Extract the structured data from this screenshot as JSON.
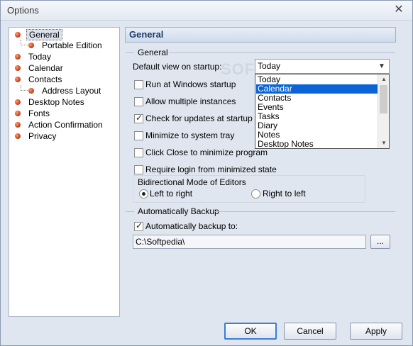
{
  "window": {
    "title": "Options"
  },
  "tree": {
    "items": [
      {
        "label": "General"
      },
      {
        "label": "Portable Edition"
      },
      {
        "label": "Today"
      },
      {
        "label": "Calendar"
      },
      {
        "label": "Contacts"
      },
      {
        "label": "Address Layout"
      },
      {
        "label": "Desktop Notes"
      },
      {
        "label": "Fonts"
      },
      {
        "label": "Action Confirmation"
      },
      {
        "label": "Privacy"
      }
    ]
  },
  "panel": {
    "header": "General",
    "general_group": "General",
    "default_view_label": "Default view on startup:",
    "default_view_value": "Today",
    "dropdown_options": [
      "Today",
      "Calendar",
      "Contacts",
      "Events",
      "Tasks",
      "Diary",
      "Notes",
      "Desktop Notes"
    ],
    "dropdown_highlighted": "Calendar",
    "checkboxes": [
      {
        "label": "Run at Windows startup",
        "checked": false
      },
      {
        "label": "Allow multiple instances",
        "checked": false
      },
      {
        "label": "Check for updates at startup",
        "checked": true
      },
      {
        "label": "Minimize to system tray",
        "checked": false
      },
      {
        "label": "Click Close to minimize program",
        "checked": false
      },
      {
        "label": "Require login from minimized state",
        "checked": false
      }
    ],
    "bidi_title": "Bidirectional Mode of Editors",
    "bidi_options": [
      {
        "label": "Left to right",
        "checked": true
      },
      {
        "label": "Right to left",
        "checked": false
      }
    ],
    "backup_group": "Automatically Backup",
    "backup_checkbox": {
      "label": "Automatically backup to:",
      "checked": true
    },
    "backup_path": "C:\\Softpedia\\",
    "browse_label": "..."
  },
  "buttons": {
    "ok": "OK",
    "cancel": "Cancel",
    "apply": "Apply"
  },
  "watermark": "SOFTPEDIA",
  "colors": {
    "selection": "#0a64d6",
    "header_text": "#1f3b6e",
    "default_button_border": "#3b7dd8"
  }
}
